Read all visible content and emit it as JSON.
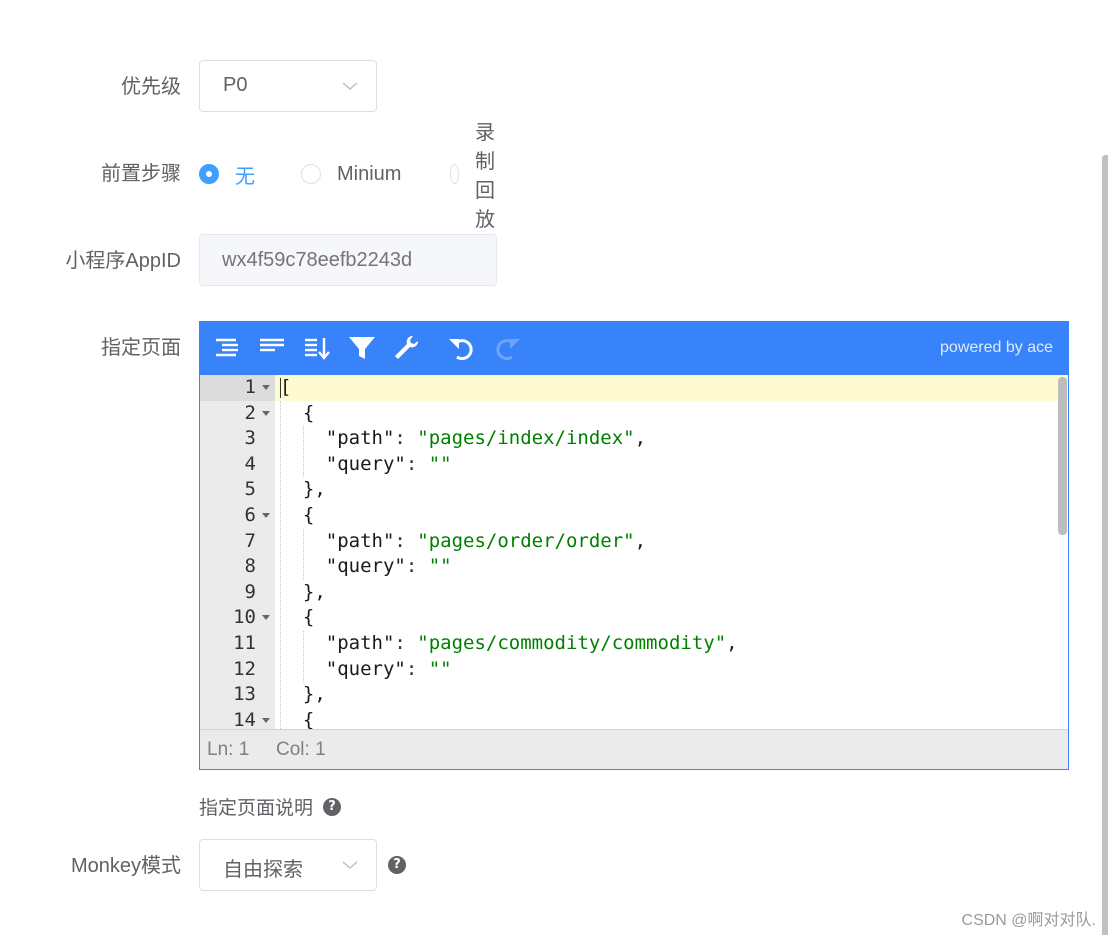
{
  "form": {
    "priority": {
      "label": "优先级",
      "value": "P0"
    },
    "pre_steps": {
      "label": "前置步骤",
      "options": [
        {
          "label": "无",
          "checked": true
        },
        {
          "label": "Minium",
          "checked": false
        },
        {
          "label": "录制回放",
          "checked": false
        }
      ]
    },
    "appid": {
      "label": "小程序AppID",
      "placeholder": "wx4f59c78eefb2243d"
    },
    "pages": {
      "label": "指定页面",
      "help": "指定页面说明"
    },
    "monkey": {
      "label": "Monkey模式",
      "value": "自由探索"
    }
  },
  "editor": {
    "toolbar": [
      {
        "name": "format-icon",
        "title": "Format"
      },
      {
        "name": "compact-icon",
        "title": "Compact"
      },
      {
        "name": "sort-icon",
        "title": "Sort"
      },
      {
        "name": "filter-icon",
        "title": "Filter"
      },
      {
        "name": "repair-icon",
        "title": "Repair"
      },
      {
        "name": "undo-icon",
        "title": "Undo"
      },
      {
        "name": "redo-icon",
        "title": "Redo"
      }
    ],
    "powered_by": "powered by ace",
    "lines": [
      {
        "n": "1",
        "fold": true,
        "text": "["
      },
      {
        "n": "2",
        "fold": true,
        "text": "  {"
      },
      {
        "n": "3",
        "fold": false,
        "key": "\"path\"",
        "val": "\"pages/index/index\"",
        "tail": ","
      },
      {
        "n": "4",
        "fold": false,
        "key": "\"query\"",
        "val": "\"\"",
        "tail": ""
      },
      {
        "n": "5",
        "fold": false,
        "text": "  },"
      },
      {
        "n": "6",
        "fold": true,
        "text": "  {"
      },
      {
        "n": "7",
        "fold": false,
        "key": "\"path\"",
        "val": "\"pages/order/order\"",
        "tail": ","
      },
      {
        "n": "8",
        "fold": false,
        "key": "\"query\"",
        "val": "\"\"",
        "tail": ""
      },
      {
        "n": "9",
        "fold": false,
        "text": "  },"
      },
      {
        "n": "10",
        "fold": true,
        "text": "  {"
      },
      {
        "n": "11",
        "fold": false,
        "key": "\"path\"",
        "val": "\"pages/commodity/commodity\"",
        "tail": ","
      },
      {
        "n": "12",
        "fold": false,
        "key": "\"query\"",
        "val": "\"\"",
        "tail": ""
      },
      {
        "n": "13",
        "fold": false,
        "text": "  },"
      },
      {
        "n": "14",
        "fold": true,
        "text": "  {"
      }
    ],
    "status": {
      "ln": "Ln: 1",
      "col": "Col: 1"
    },
    "colors": {
      "menu": "#3883fa",
      "string": "#008000",
      "active_line": "#fffbd1"
    }
  },
  "watermark": "CSDN @啊对对队."
}
